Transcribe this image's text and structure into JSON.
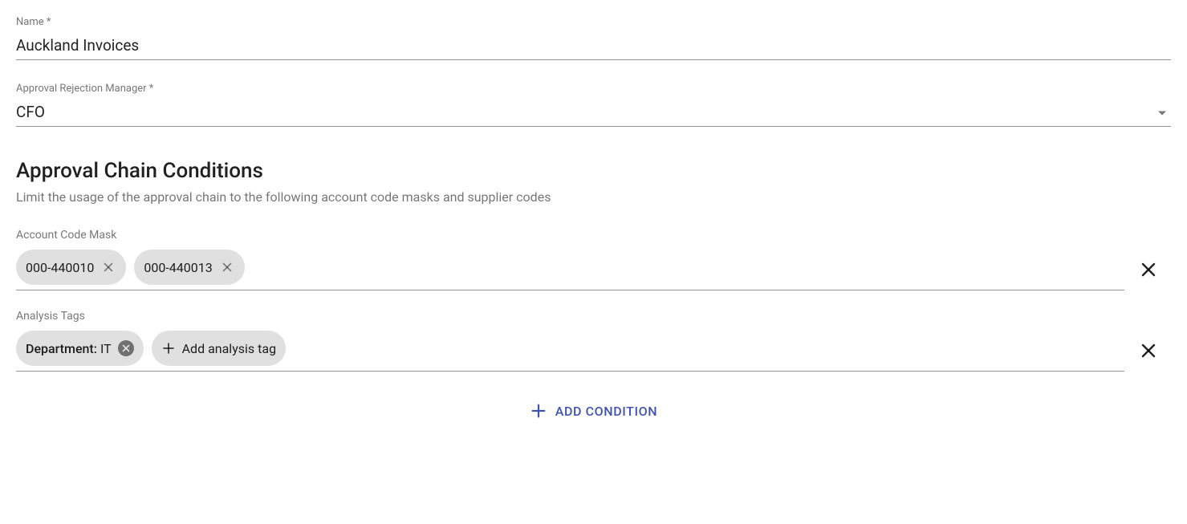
{
  "fields": {
    "name": {
      "label": "Name *",
      "value": "Auckland Invoices"
    },
    "approvalRejectionManager": {
      "label": "Approval Rejection Manager *",
      "value": "CFO"
    }
  },
  "conditionsSection": {
    "title": "Approval Chain Conditions",
    "description": "Limit the usage of the approval chain to the following account code masks and supplier codes"
  },
  "conditions": {
    "accountCodeMask": {
      "label": "Account Code Mask",
      "chips": [
        "000-440010",
        "000-440013"
      ]
    },
    "analysisTags": {
      "label": "Analysis Tags",
      "tag": {
        "key": "Department:",
        "value": "IT"
      },
      "addLabel": "Add analysis tag"
    }
  },
  "actions": {
    "addCondition": "ADD CONDITION"
  }
}
